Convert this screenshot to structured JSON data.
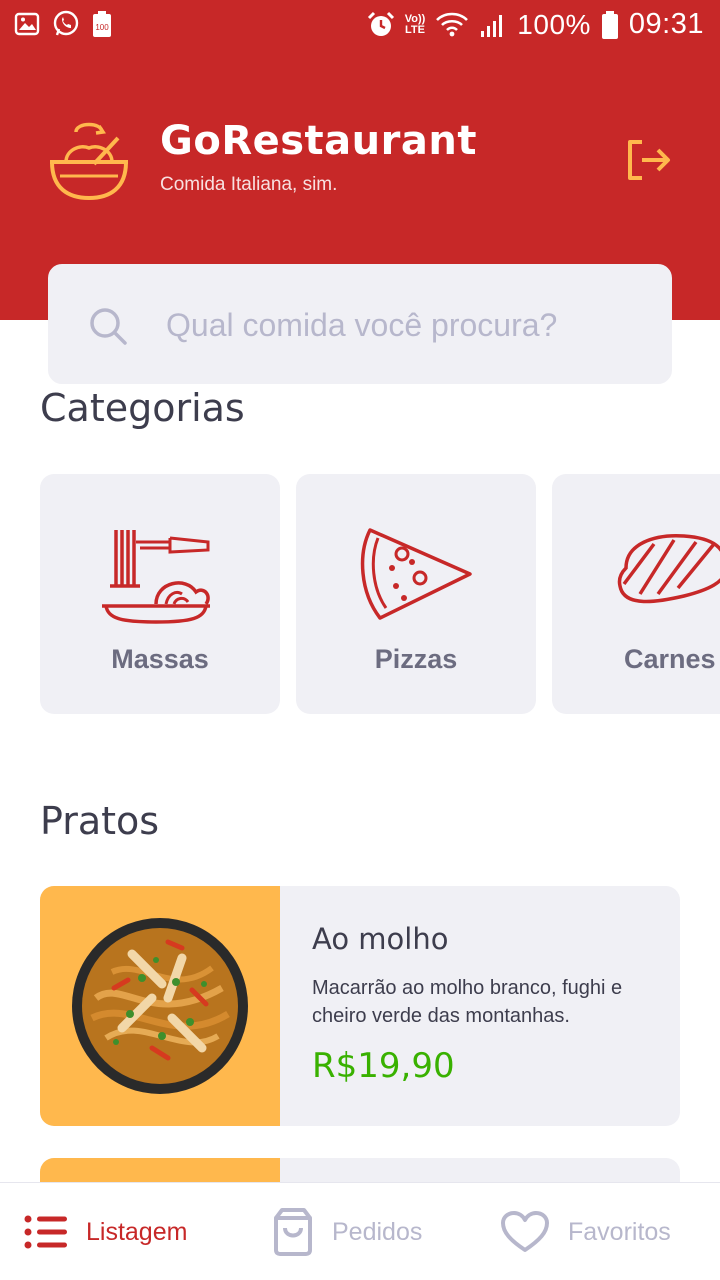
{
  "status_bar": {
    "battery_percent": "100%",
    "time": "09:31",
    "network": "LTE",
    "battery_badge": "100"
  },
  "header": {
    "title": "GoRestaurant",
    "subtitle": "Comida Italiana, sim."
  },
  "search": {
    "placeholder": "Qual comida você procura?"
  },
  "categories": {
    "title": "Categorias",
    "items": [
      {
        "label": "Massas",
        "icon": "pasta-icon"
      },
      {
        "label": "Pizzas",
        "icon": "pizza-icon"
      },
      {
        "label": "Carnes",
        "icon": "steak-icon"
      }
    ]
  },
  "dishes": {
    "title": "Pratos",
    "items": [
      {
        "name": "Ao molho",
        "description": "Macarrão ao molho branco, fughi e cheiro verde das montanhas.",
        "price": "R$19,90"
      }
    ]
  },
  "bottom_nav": {
    "items": [
      {
        "label": "Listagem",
        "icon": "list-icon",
        "active": true
      },
      {
        "label": "Pedidos",
        "icon": "shopping-bag-icon",
        "active": false
      },
      {
        "label": "Favoritos",
        "icon": "heart-icon",
        "active": false
      }
    ]
  },
  "colors": {
    "primary": "#c72828",
    "accent": "#ffb84d",
    "card": "#f0f0f5",
    "price": "#39b100",
    "muted": "#6c6c80",
    "placeholder": "#b7b7cc"
  }
}
